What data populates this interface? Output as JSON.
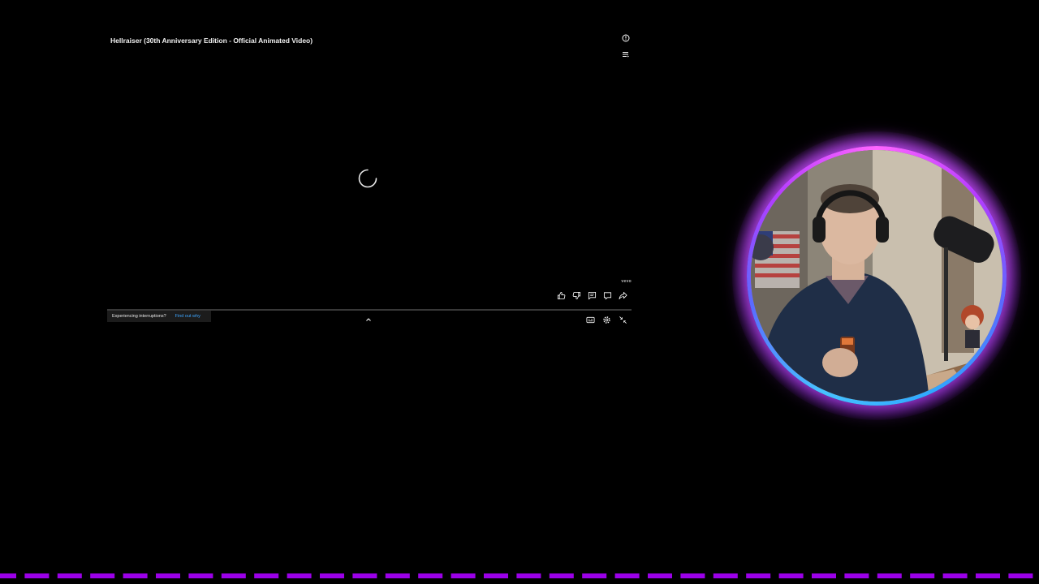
{
  "player": {
    "title": "Hellraiser (30th Anniversary Edition - Official Animated Video)",
    "channel_badge": "vevo",
    "progress_percent": 0,
    "interruption_notice": {
      "message": "Experiencing interruptions?",
      "link": "Find out why"
    },
    "top_icons": [
      "info-icon",
      "queue-icon"
    ],
    "actions": [
      "like-icon",
      "dislike-icon",
      "comments-icon",
      "live-chat-icon",
      "share-icon"
    ],
    "controls": [
      "captions-icon",
      "settings-icon",
      "exit-fullscreen-icon"
    ]
  },
  "colors": {
    "background": "#000000",
    "link": "#3ea6ff",
    "ring_top": "#ff66ff",
    "ring_bottom": "#2fa8ff",
    "dash": "#9b00e8"
  }
}
